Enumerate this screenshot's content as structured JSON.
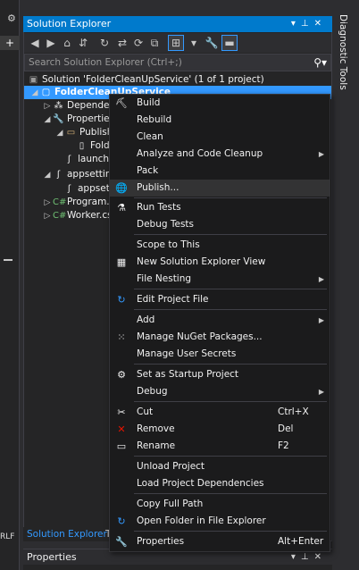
{
  "left_strip": {
    "tab_glyph": "+",
    "status_text": "RLF"
  },
  "solution_explorer": {
    "title": "Solution Explorer",
    "search_placeholder": "Search Solution Explorer (Ctrl+;)",
    "tree": [
      {
        "label": "Solution 'FolderCleanUpService' (1 of 1 project)",
        "icon": "solution-icon"
      },
      {
        "label": "FolderCleanUpService",
        "icon": "csharp-project-icon",
        "selected": true
      },
      {
        "label": "Dependencies",
        "icon": "dependencies-icon"
      },
      {
        "label": "Properties",
        "icon": "wrench-icon"
      },
      {
        "label": "PublishProfiles",
        "icon": "folder-icon"
      },
      {
        "label": "FolderProfile.pubxml",
        "icon": "file-icon"
      },
      {
        "label": "launchSettings.json",
        "icon": "json-icon"
      },
      {
        "label": "appsettings.json",
        "icon": "json-icon"
      },
      {
        "label": "appsettings.Development.json",
        "icon": "json-icon"
      },
      {
        "label": "Program.cs",
        "icon": "csharp-file-icon"
      },
      {
        "label": "Worker.cs",
        "icon": "csharp-file-icon"
      }
    ],
    "bottom_tabs": [
      "Solution Explorer",
      "Te"
    ]
  },
  "diagnostic_tools": {
    "label": "Diagnostic Tools"
  },
  "properties_bar": {
    "title": "Properties"
  },
  "context_menu": {
    "items": [
      {
        "label": "Build",
        "icon": "build-icon"
      },
      {
        "label": "Rebuild"
      },
      {
        "label": "Clean"
      },
      {
        "label": "Analyze and Code Cleanup",
        "submenu": true
      },
      {
        "label": "Pack"
      },
      {
        "label": "Publish...",
        "icon": "globe-icon",
        "hover": true
      },
      {
        "label": "Run Tests",
        "icon": "flask-icon"
      },
      {
        "label": "Debug Tests"
      },
      {
        "label": "Scope to This"
      },
      {
        "label": "New Solution Explorer View",
        "icon": "new-view-icon"
      },
      {
        "label": "File Nesting",
        "submenu": true
      },
      {
        "label": "Edit Project File",
        "icon": "refresh-icon"
      },
      {
        "label": "Add",
        "submenu": true
      },
      {
        "label": "Manage NuGet Packages...",
        "icon": "nuget-icon"
      },
      {
        "label": "Manage User Secrets"
      },
      {
        "label": "Set as Startup Project",
        "icon": "gear-icon"
      },
      {
        "label": "Debug",
        "submenu": true
      },
      {
        "label": "Cut",
        "icon": "scissors-icon",
        "shortcut": "Ctrl+X"
      },
      {
        "label": "Remove",
        "icon": "remove-icon",
        "shortcut": "Del"
      },
      {
        "label": "Rename",
        "icon": "rename-icon",
        "shortcut": "F2"
      },
      {
        "label": "Unload Project"
      },
      {
        "label": "Load Project Dependencies"
      },
      {
        "label": "Copy Full Path"
      },
      {
        "label": "Open Folder in File Explorer",
        "icon": "refresh-icon"
      },
      {
        "label": "Properties",
        "icon": "wrench-icon",
        "shortcut": "Alt+Enter"
      }
    ]
  },
  "colors": {
    "accent": "#007acc",
    "selection": "#3399ff",
    "menu_bg": "#1b1b1c",
    "panel_bg": "#252526"
  }
}
